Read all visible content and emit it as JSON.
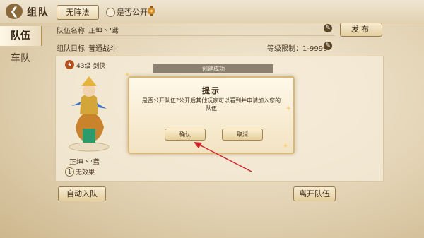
{
  "header": {
    "back_icon": "back-arrow-icon",
    "title": "组队",
    "formation_label": "无阵法",
    "public_label": "是否公开",
    "lantern_icon": "lantern-icon"
  },
  "tabs": [
    {
      "label": "队伍",
      "active": true
    },
    {
      "label": "车队",
      "active": false
    }
  ],
  "team_name": {
    "label": "队伍名称",
    "value": "正坤丶'鸢"
  },
  "publish_label": "发布",
  "team_goal": {
    "label": "组队目标",
    "value": "普通战斗"
  },
  "level_limit": {
    "label": "等级限制：1-9999"
  },
  "member": {
    "level": "43级",
    "class": "剑侠",
    "badge_icon": "level-badge-icon",
    "name": "正坤丶'鸢",
    "effect_index": "1",
    "effect": "无效果"
  },
  "created_notice": "创建成功",
  "dialog": {
    "title": "提示",
    "message": "是否公开队伍?公开后其他玩家可以看到并申请加入您的队伍",
    "confirm": "确认",
    "cancel": "取消"
  },
  "bottom": {
    "auto_join": "自动入队",
    "leave_team": "离开队伍"
  },
  "colors": {
    "accent": "#8a6a3c",
    "arrow": "#d2232a",
    "dialog_border": "#d9b877"
  }
}
